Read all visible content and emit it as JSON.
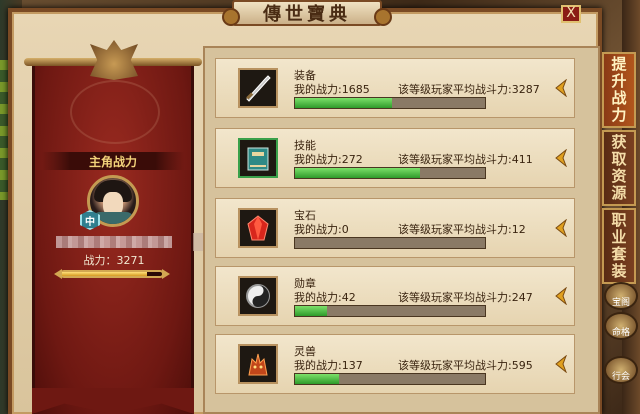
{
  "dialog": {
    "title": "傳世寶典",
    "close_label": "X"
  },
  "hero": {
    "title": "主角战力",
    "rank_badge": "中",
    "power_label": "战力：3271",
    "power_progress": 0.85
  },
  "categories": [
    {
      "name": "装备",
      "icon": "sword-icon",
      "my_power_label": "我的战力:1685",
      "avg_label": "该等级玩家平均战斗力:3287",
      "progress": 0.51
    },
    {
      "name": "技能",
      "icon": "skill-book-icon",
      "my_power_label": "我的战力:272",
      "avg_label": "该等级玩家平均战斗力:411",
      "progress": 0.66
    },
    {
      "name": "宝石",
      "icon": "gem-icon",
      "my_power_label": "我的战力:0",
      "avg_label": "该等级玩家平均战斗力:12",
      "progress": 0.0
    },
    {
      "name": "勋章",
      "icon": "yinyang-medal-icon",
      "my_power_label": "我的战力:42",
      "avg_label": "该等级玩家平均战斗力:247",
      "progress": 0.17
    },
    {
      "name": "灵兽",
      "icon": "spirit-beast-icon",
      "my_power_label": "我的战力:137",
      "avg_label": "该等级玩家平均战斗力:595",
      "progress": 0.23
    }
  ],
  "side_tabs": [
    {
      "label": "提升战力",
      "active": true
    },
    {
      "label": "获取资源",
      "active": false
    },
    {
      "label": "职业套装",
      "active": false
    }
  ],
  "side_shortcuts": [
    "宝阁",
    "命格",
    "行会"
  ],
  "colors": {
    "accent_gold": "#d2a852",
    "progress_green": "#2e9a2a",
    "banner_red": "#6e1812"
  }
}
